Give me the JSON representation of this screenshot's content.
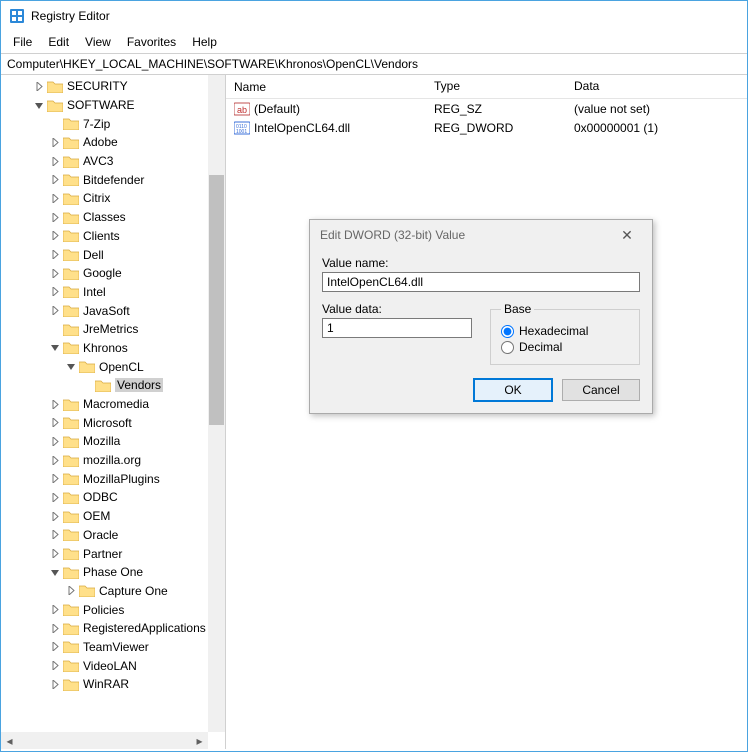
{
  "window": {
    "title": "Registry Editor"
  },
  "menu": {
    "file": "File",
    "edit": "Edit",
    "view": "View",
    "favorites": "Favorites",
    "help": "Help"
  },
  "address": "Computer\\HKEY_LOCAL_MACHINE\\SOFTWARE\\Khronos\\OpenCL\\Vendors",
  "tree": {
    "items": [
      {
        "indent": 30,
        "twisty": "right",
        "label": "SECURITY"
      },
      {
        "indent": 30,
        "twisty": "down",
        "label": "SOFTWARE"
      },
      {
        "indent": 46,
        "twisty": "none",
        "label": "7-Zip"
      },
      {
        "indent": 46,
        "twisty": "right",
        "label": "Adobe"
      },
      {
        "indent": 46,
        "twisty": "right",
        "label": "AVC3"
      },
      {
        "indent": 46,
        "twisty": "right",
        "label": "Bitdefender"
      },
      {
        "indent": 46,
        "twisty": "right",
        "label": "Citrix"
      },
      {
        "indent": 46,
        "twisty": "right",
        "label": "Classes"
      },
      {
        "indent": 46,
        "twisty": "right",
        "label": "Clients"
      },
      {
        "indent": 46,
        "twisty": "right",
        "label": "Dell"
      },
      {
        "indent": 46,
        "twisty": "right",
        "label": "Google"
      },
      {
        "indent": 46,
        "twisty": "right",
        "label": "Intel"
      },
      {
        "indent": 46,
        "twisty": "right",
        "label": "JavaSoft"
      },
      {
        "indent": 46,
        "twisty": "none",
        "label": "JreMetrics"
      },
      {
        "indent": 46,
        "twisty": "down",
        "label": "Khronos"
      },
      {
        "indent": 62,
        "twisty": "down",
        "label": "OpenCL"
      },
      {
        "indent": 78,
        "twisty": "none",
        "label": "Vendors",
        "selected": true
      },
      {
        "indent": 46,
        "twisty": "right",
        "label": "Macromedia"
      },
      {
        "indent": 46,
        "twisty": "right",
        "label": "Microsoft"
      },
      {
        "indent": 46,
        "twisty": "right",
        "label": "Mozilla"
      },
      {
        "indent": 46,
        "twisty": "right",
        "label": "mozilla.org"
      },
      {
        "indent": 46,
        "twisty": "right",
        "label": "MozillaPlugins"
      },
      {
        "indent": 46,
        "twisty": "right",
        "label": "ODBC"
      },
      {
        "indent": 46,
        "twisty": "right",
        "label": "OEM"
      },
      {
        "indent": 46,
        "twisty": "right",
        "label": "Oracle"
      },
      {
        "indent": 46,
        "twisty": "right",
        "label": "Partner"
      },
      {
        "indent": 46,
        "twisty": "down",
        "label": "Phase One"
      },
      {
        "indent": 62,
        "twisty": "right",
        "label": "Capture One"
      },
      {
        "indent": 46,
        "twisty": "right",
        "label": "Policies"
      },
      {
        "indent": 46,
        "twisty": "right",
        "label": "RegisteredApplications"
      },
      {
        "indent": 46,
        "twisty": "right",
        "label": "TeamViewer"
      },
      {
        "indent": 46,
        "twisty": "right",
        "label": "VideoLAN"
      },
      {
        "indent": 46,
        "twisty": "right",
        "label": "WinRAR"
      }
    ]
  },
  "list": {
    "headers": {
      "name": "Name",
      "type": "Type",
      "data": "Data"
    },
    "rows": [
      {
        "icon": "string",
        "name": "(Default)",
        "type": "REG_SZ",
        "data": "(value not set)"
      },
      {
        "icon": "binary",
        "name": "IntelOpenCL64.dll",
        "type": "REG_DWORD",
        "data": "0x00000001 (1)"
      }
    ]
  },
  "dialog": {
    "title": "Edit DWORD (32-bit) Value",
    "value_name_label": "Value name:",
    "value_name": "IntelOpenCL64.dll",
    "value_data_label": "Value data:",
    "value_data": "1",
    "base_label": "Base",
    "hex_label": "Hexadecimal",
    "dec_label": "Decimal",
    "ok": "OK",
    "cancel": "Cancel"
  }
}
